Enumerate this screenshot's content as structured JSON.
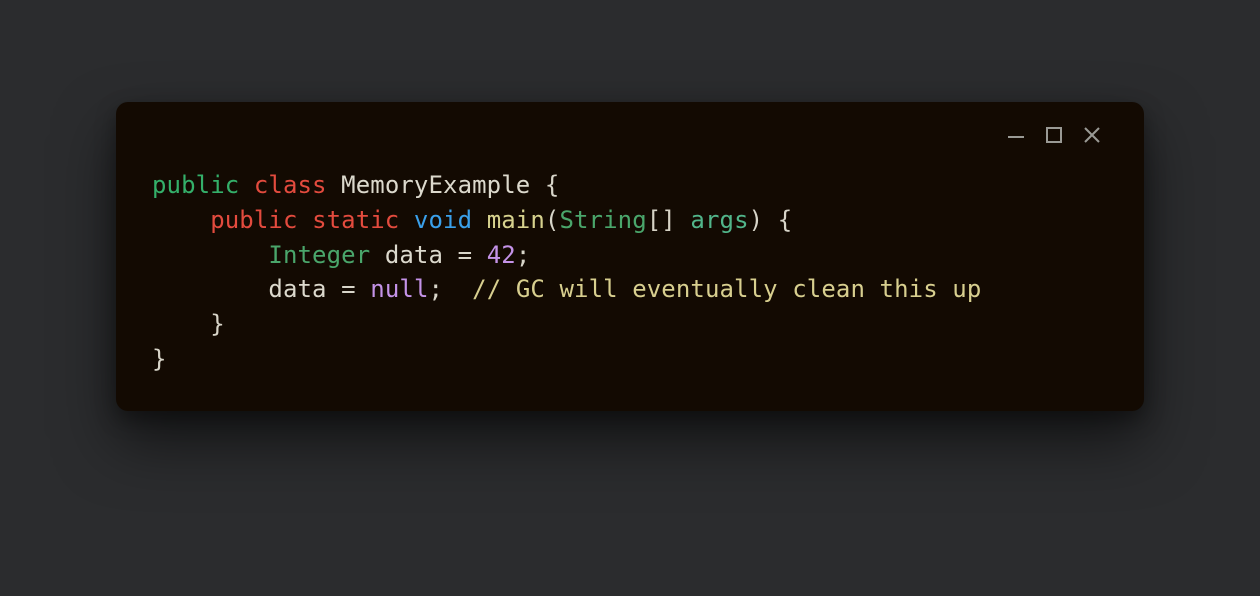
{
  "window": {
    "minimize_label": "Minimize",
    "maximize_label": "Maximize",
    "close_label": "Close"
  },
  "code": {
    "line1": {
      "kw_public": "public",
      "kw_class": "class",
      "class_name": "MemoryExample",
      "brace_open": "{"
    },
    "line2": {
      "indent": "    ",
      "kw_public": "public",
      "kw_static": "static",
      "kw_void": "void",
      "method_name": "main",
      "paren_open": "(",
      "param_type": "String",
      "brackets": "[]",
      "param_name": "args",
      "paren_close": ")",
      "brace_open": "{"
    },
    "line3": {
      "indent": "        ",
      "type": "Integer",
      "var": "data",
      "eq": "=",
      "value": "42",
      "semi": ";"
    },
    "line4": {
      "indent": "        ",
      "var": "data",
      "eq": "=",
      "null": "null",
      "semi": ";",
      "gap": "  ",
      "comment": "// GC will eventually clean this up"
    },
    "line5": {
      "indent": "    ",
      "brace_close": "}"
    },
    "line6": {
      "brace_close": "}"
    }
  }
}
